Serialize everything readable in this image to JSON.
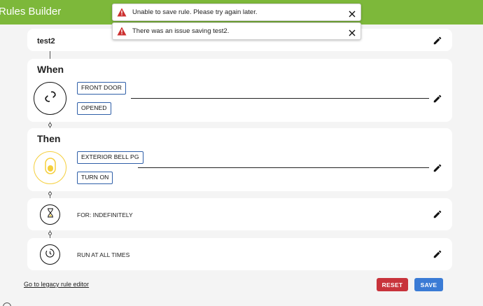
{
  "header": {
    "title": "Rules Builder"
  },
  "rule": {
    "name": "test2"
  },
  "when": {
    "title": "When",
    "chips": [
      "FRONT DOOR",
      "OPENED"
    ]
  },
  "then": {
    "title": "Then",
    "chips": [
      "EXTERIOR BELL PG",
      "TURN ON"
    ]
  },
  "duration": {
    "text": "FOR: INDEFINITELY"
  },
  "schedule": {
    "text": "RUN AT ALL TIMES"
  },
  "footer": {
    "legacy_link": "Go to legacy rule editor",
    "reset_label": "RESET",
    "save_label": "SAVE"
  },
  "toasts": [
    {
      "message": "Unable to save rule. Please try again later."
    },
    {
      "message": "There was an issue saving test2."
    }
  ],
  "colors": {
    "header": "#7db83a",
    "reset": "#c8333b",
    "save": "#3a7bd5",
    "warning": "#cc2f2f",
    "light_yellow": "#f5cf3c",
    "chip_border": "#2f5fa8"
  },
  "icons": {
    "edit": "pencil-icon",
    "when": "link-icon",
    "then": "light-switch-icon",
    "duration": "hourglass-icon",
    "schedule": "clock-icon",
    "toast_warning": "warning-triangle-icon",
    "toast_close": "close-icon"
  }
}
